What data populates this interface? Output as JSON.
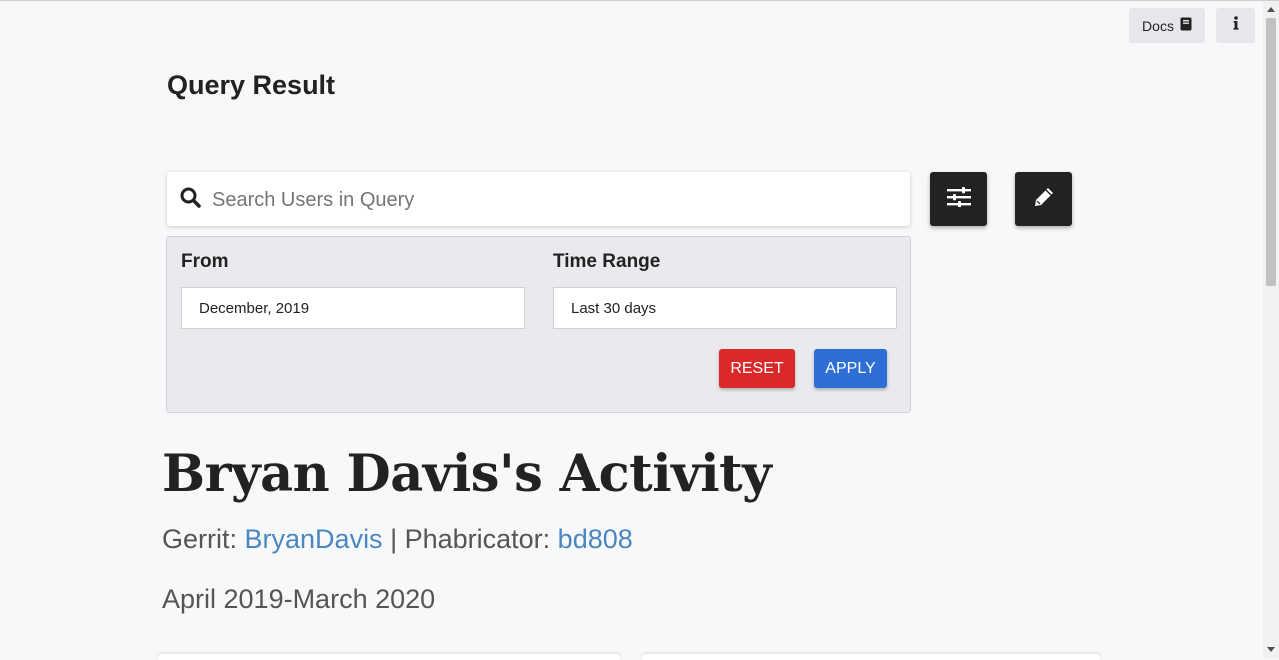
{
  "header": {
    "docs_label": "Docs",
    "docs_icon": "book-icon",
    "info_icon": "info-icon"
  },
  "page": {
    "title": "Query Result"
  },
  "search": {
    "placeholder": "Search Users in Query",
    "value": "",
    "icon": "search-icon"
  },
  "toolbar": {
    "filter_icon": "sliders-icon",
    "edit_icon": "pencil-icon"
  },
  "filters": {
    "from_label": "From",
    "from_value": "December, 2019",
    "range_label": "Time Range",
    "range_value": "Last 30 days",
    "reset_label": "RESET",
    "apply_label": "APPLY"
  },
  "user": {
    "activity_title": "Bryan Davis's Activity",
    "gerrit_label": "Gerrit: ",
    "gerrit_user": "BryanDavis",
    "separator": " | ",
    "phab_label": "Phabricator: ",
    "phab_user": "bd808",
    "period": "April 2019-March 2020"
  },
  "colors": {
    "reset": "#db2828",
    "apply": "#2e6fd6",
    "link": "#4a87c0",
    "dark_button": "#222222"
  }
}
